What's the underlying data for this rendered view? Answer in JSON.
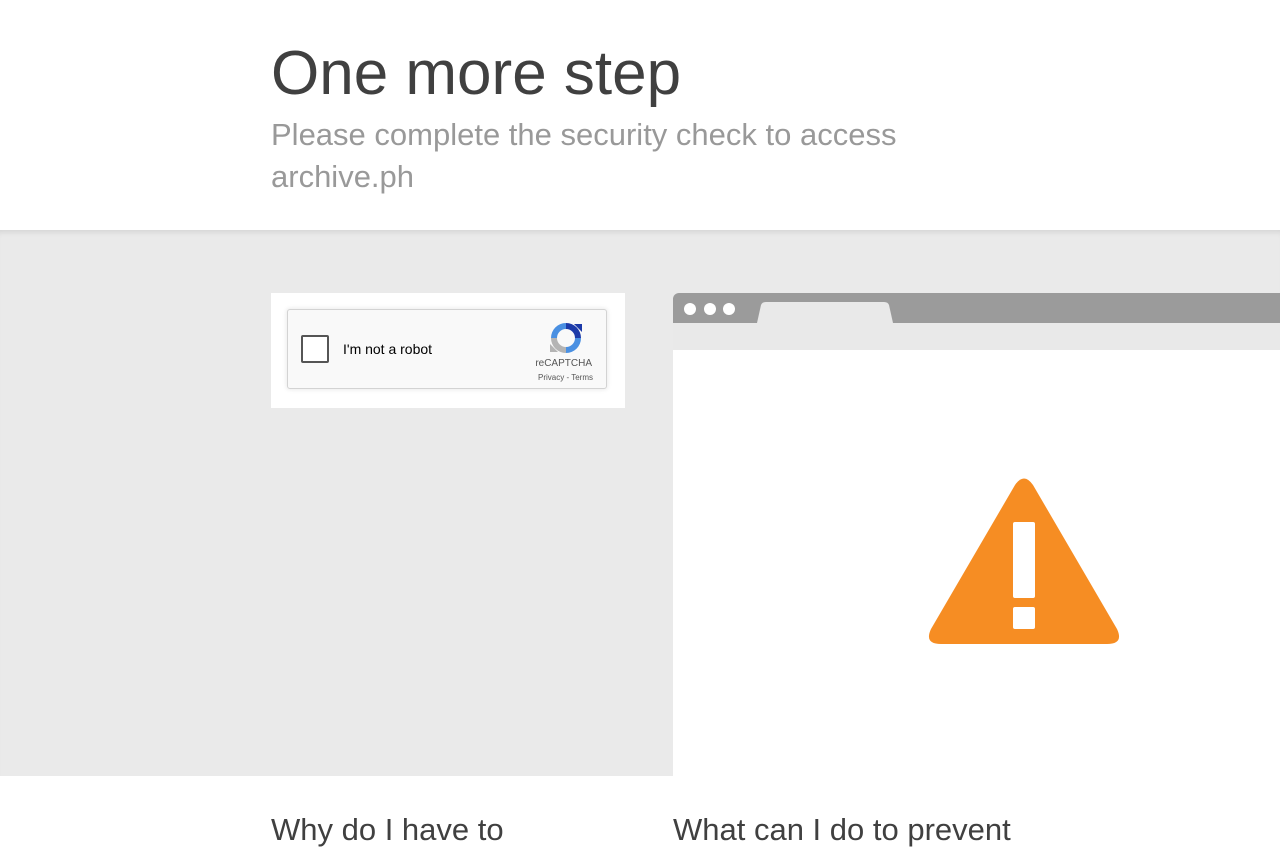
{
  "header": {
    "title": "One more step",
    "subtitle": "Please complete the security check to access archive.ph"
  },
  "captcha": {
    "checkbox_label": "I'm not a robot",
    "brand": "reCAPTCHA",
    "privacy_link": "Privacy",
    "separator": "-",
    "terms_link": "Terms"
  },
  "browser_illustration": {
    "icon": "warning-triangle-icon",
    "icon_color": "#f68d23"
  },
  "sections": {
    "why_heading": "Why do I have to",
    "prevent_heading": "What can I do to prevent"
  },
  "colors": {
    "band_background": "#eaeaea",
    "title_text": "#404040",
    "subtitle_text": "#999999"
  }
}
